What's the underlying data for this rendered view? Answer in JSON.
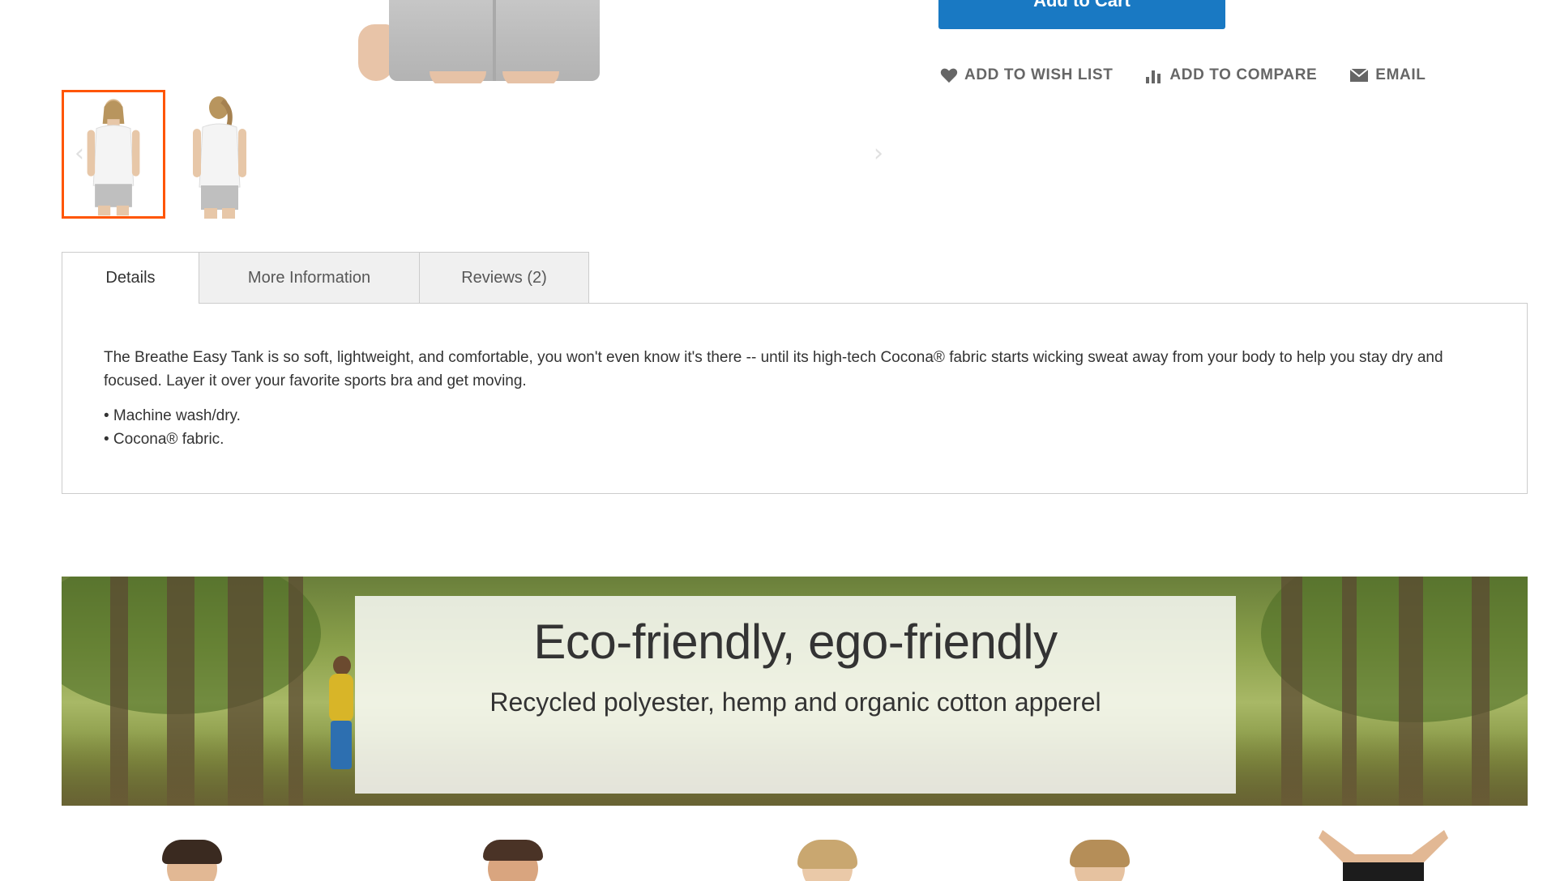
{
  "product": {
    "add_to_cart_label": "Add to Cart",
    "actions": {
      "wishlist_label": "ADD TO WISH LIST",
      "compare_label": "ADD TO COMPARE",
      "email_label": "EMAIL"
    }
  },
  "gallery": {
    "prev_glyph": "‹",
    "next_glyph": "›",
    "thumbnails": [
      {
        "name": "front-view",
        "active": true
      },
      {
        "name": "back-view",
        "active": false
      }
    ]
  },
  "tabs": {
    "items": [
      {
        "label": "Details",
        "active": true
      },
      {
        "label": "More Information",
        "active": false
      },
      {
        "label": "Reviews (2)",
        "active": false
      }
    ],
    "details": {
      "description": "The Breathe Easy Tank is so soft, lightweight, and comfortable, you won't even know it's there -- until its high-tech Cocona® fabric starts wicking sweat away from your body to help you stay dry and focused. Layer it over your favorite sports bra and get moving.",
      "bullets": [
        "• Machine wash/dry.",
        "• Cocona® fabric."
      ]
    }
  },
  "banner": {
    "title": "Eco-friendly, ego-friendly",
    "subtitle": "Recycled polyester, hemp and organic cotton apperel"
  },
  "colors": {
    "primary_button": "#1979c3",
    "active_thumb_border": "#ff5501",
    "action_text": "#666666"
  },
  "icons": {
    "wishlist": "heart-icon",
    "compare": "bar-chart-icon",
    "email": "envelope-icon"
  }
}
